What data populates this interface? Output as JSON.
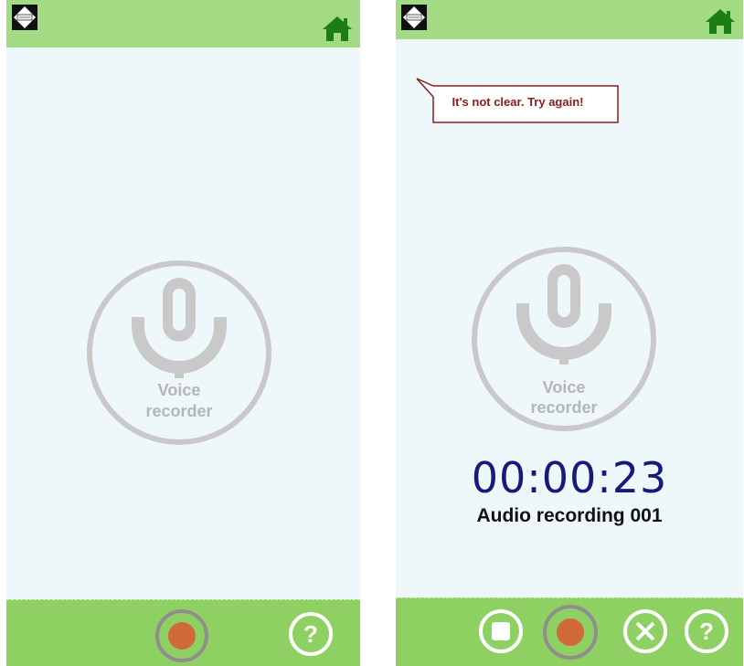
{
  "left": {
    "mic": {
      "line1": "Voice",
      "line2": "recorder"
    }
  },
  "right": {
    "tooltip": "It's not clear. Try again!",
    "mic": {
      "line1": "Voice",
      "line2": "recorder"
    },
    "timer": "00:00:23",
    "recording_name": "Audio recording 001"
  },
  "colors": {
    "background": "#eef8fb",
    "topbar": "#a3da84",
    "bottombar": "#8fd062",
    "home_icon": "#1b7d12",
    "record_dot": "#d06a38",
    "mic_gray": "#c9c9c9",
    "timer": "#141b7a",
    "tooltip_text": "#8b1b1b"
  },
  "icons": {
    "logo": "app-logo-icon",
    "home": "home-icon",
    "microphone": "microphone-icon",
    "record": "record-icon",
    "help": "help-icon",
    "stop": "stop-icon",
    "cancel": "cancel-icon"
  }
}
